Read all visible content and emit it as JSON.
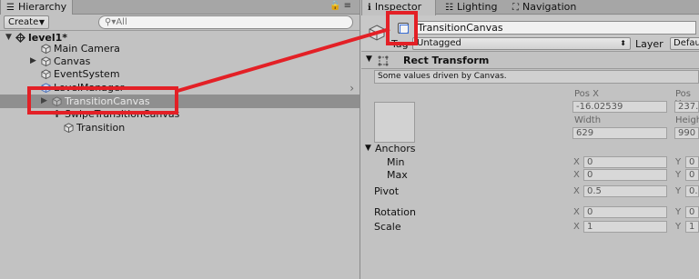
{
  "hierarchy": {
    "tab_label": "Hierarchy",
    "create_label": "Create",
    "search_placeholder": "All",
    "scene": "level1*",
    "items": [
      {
        "label": "Main Camera"
      },
      {
        "label": "Canvas"
      },
      {
        "label": "EventSystem"
      },
      {
        "label": "LevelManager"
      },
      {
        "label": "TransitionCanvas"
      },
      {
        "label": "SwipeTransitionCanvas"
      },
      {
        "label": "Transition"
      }
    ]
  },
  "inspector": {
    "tabs": [
      {
        "label": "Inspector"
      },
      {
        "label": "Lighting"
      },
      {
        "label": "Navigation"
      }
    ],
    "object_name": "TransitionCanvas",
    "tag_label": "Tag",
    "tag_value": "Untagged",
    "layer_label": "Layer",
    "layer_value": "Default",
    "component_title": "Rect Transform",
    "note": "Some values driven by Canvas.",
    "pos_x_label": "Pos X",
    "pos_y_label": "Pos Y",
    "pos_x": "-16.02539",
    "pos_y": "237.",
    "width_label": "Width",
    "height_label": "Heigh",
    "width": "629",
    "height": "990",
    "anchors_label": "Anchors",
    "min_label": "Min",
    "max_label": "Max",
    "pivot_label": "Pivot",
    "rotation_label": "Rotation",
    "scale_label": "Scale",
    "x_axis": "X",
    "y_axis": "Y",
    "min_x": "0",
    "min_y": "0",
    "max_x": "0",
    "max_y": "0",
    "pivot_x": "0.5",
    "pivot_y": "0.",
    "rot_x": "0",
    "rot_y": "0",
    "scale_x": "1",
    "scale_y": "1"
  },
  "colors": {
    "annotation_red": "#e32026",
    "panel_bg": "#c2c2c2",
    "selection": "#8f8f8f"
  }
}
